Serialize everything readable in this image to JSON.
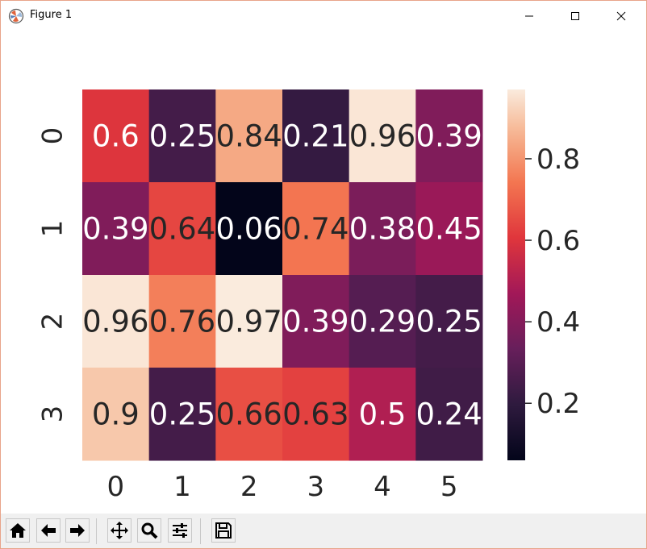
{
  "window": {
    "title": "Figure 1",
    "controls": {
      "minimize": "minimize",
      "maximize": "maximize",
      "close": "close"
    }
  },
  "chart_data": {
    "type": "heatmap",
    "x_tick_labels": [
      "0",
      "1",
      "2",
      "3",
      "4",
      "5"
    ],
    "y_tick_labels": [
      "0",
      "1",
      "2",
      "3"
    ],
    "values": [
      [
        0.6,
        0.25,
        0.84,
        0.21,
        0.96,
        0.39
      ],
      [
        0.39,
        0.64,
        0.06,
        0.74,
        0.38,
        0.45
      ],
      [
        0.96,
        0.76,
        0.97,
        0.39,
        0.29,
        0.25
      ],
      [
        0.9,
        0.25,
        0.66,
        0.63,
        0.5,
        0.24
      ]
    ],
    "value_labels": [
      [
        "0.6",
        "0.25",
        "0.84",
        "0.21",
        "0.96",
        "0.39"
      ],
      [
        "0.39",
        "0.64",
        "0.06",
        "0.74",
        "0.38",
        "0.45"
      ],
      [
        "0.96",
        "0.76",
        "0.97",
        "0.39",
        "0.29",
        "0.25"
      ],
      [
        "0.9",
        "0.25",
        "0.66",
        "0.63",
        "0.5",
        "0.24"
      ]
    ],
    "colorbar": {
      "min": 0.06,
      "max": 0.97,
      "ticks": [
        0.2,
        0.4,
        0.6,
        0.8
      ],
      "tick_labels": [
        "0.2",
        "0.4",
        "0.6",
        "0.8"
      ]
    },
    "colormap": "rocket",
    "title": "",
    "xlabel": "",
    "ylabel": ""
  },
  "toolbar": {
    "buttons": [
      "home-icon",
      "back-arrow-icon",
      "forward-arrow-icon",
      "pan-icon",
      "zoom-icon",
      "configure-subplots-icon",
      "save-icon"
    ]
  },
  "colors": {
    "window_border": "#e8a48a",
    "toolbar_background": "#f0f0f0",
    "annotation_light": "#ffffff",
    "annotation_dark": "#262626"
  }
}
